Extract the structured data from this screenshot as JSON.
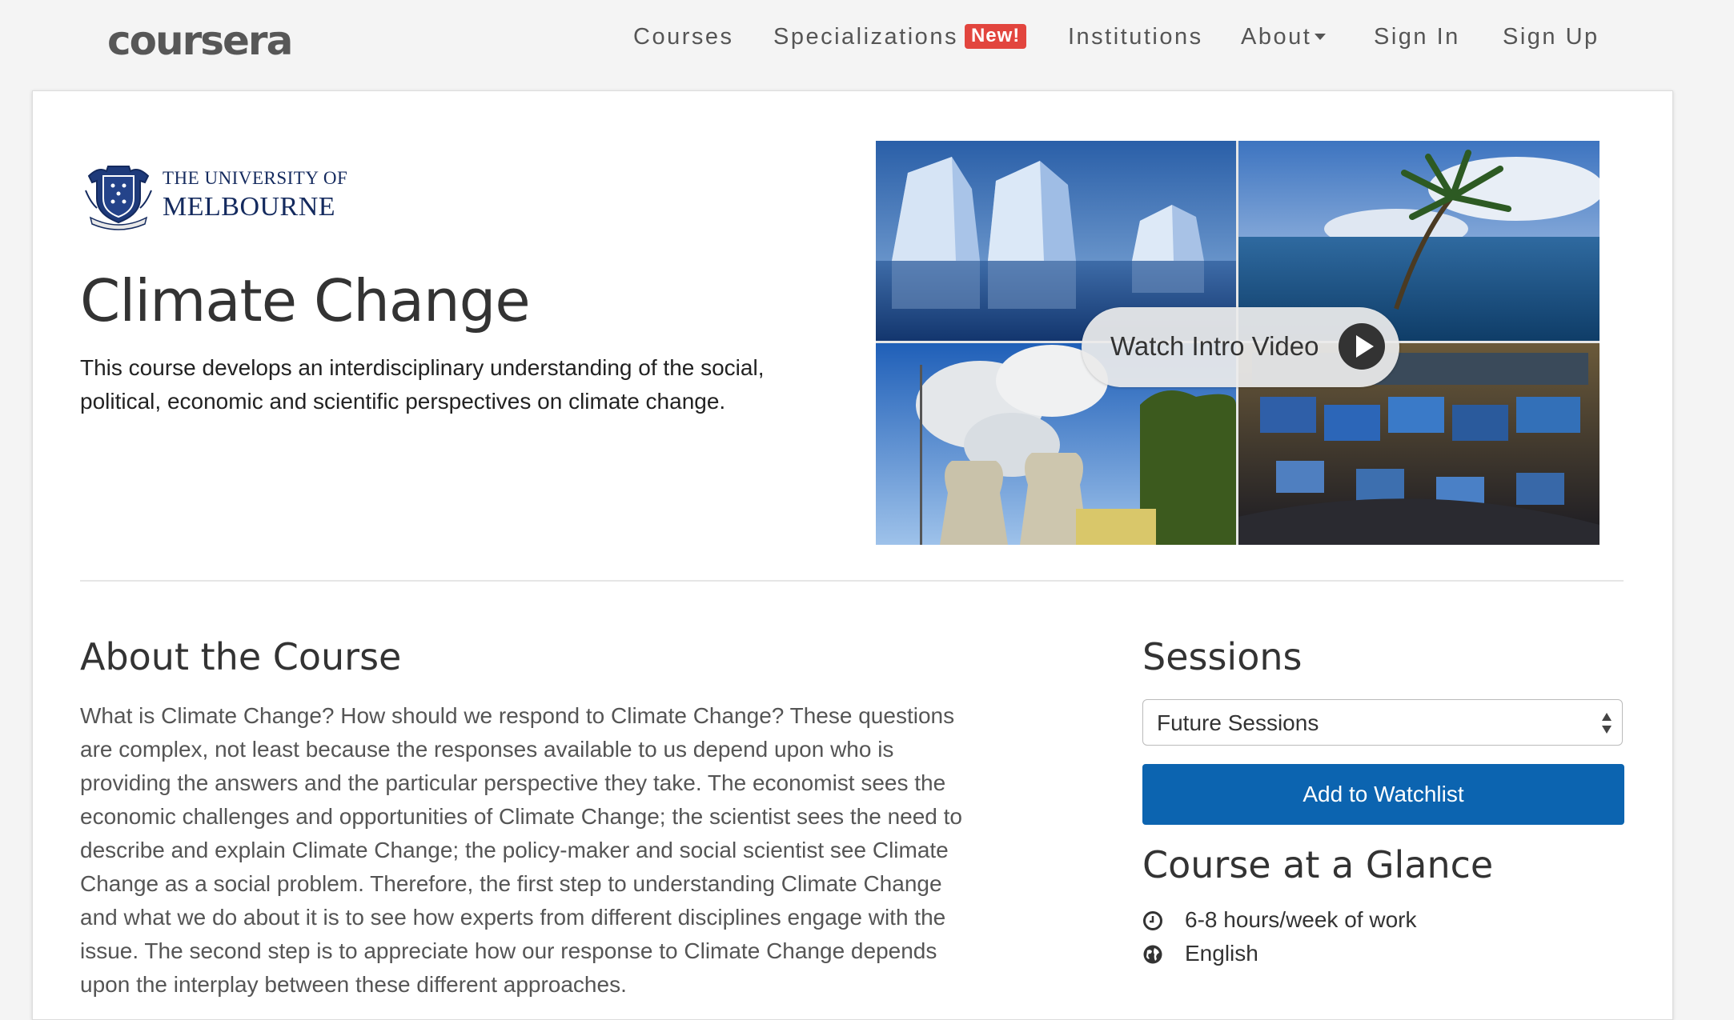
{
  "header": {
    "logo_text": "coursera",
    "nav": {
      "courses": "Courses",
      "specializations": "Specializations",
      "new_badge": "New!",
      "institutions": "Institutions",
      "about": "About",
      "sign_in": "Sign In",
      "sign_up": "Sign Up"
    }
  },
  "institution": {
    "line1": "THE UNIVERSITY OF",
    "line2": "MELBOURNE"
  },
  "course": {
    "title": "Climate Change",
    "description": "This course develops an interdisciplinary understanding of the social, political, economic and scientific perspectives on climate change."
  },
  "video": {
    "button_label": "Watch Intro Video",
    "play_icon": "play-circle-icon"
  },
  "about": {
    "title": "About the Course",
    "body": "What is Climate Change? How should we respond to Climate Change? These questions are complex, not least because the responses available to us depend upon who is providing the answers and the particular perspective they take. The economist sees the economic challenges and opportunities of Climate Change; the scientist sees the need to describe and explain Climate Change; the policy-maker and social scientist see Climate Change as a social problem. Therefore, the first step to understanding Climate Change and what we do about it is to see how experts from different disciplines engage with the issue. The second step is to appreciate how our response to Climate Change depends upon the interplay between these different approaches."
  },
  "sessions": {
    "title": "Sessions",
    "selected": "Future Sessions",
    "watchlist_button": "Add to Watchlist"
  },
  "glance": {
    "title": "Course at a Glance",
    "items": [
      {
        "icon": "clock-icon",
        "text": "6-8 hours/week of work"
      },
      {
        "icon": "globe-icon",
        "text": "English"
      }
    ]
  },
  "colors": {
    "badge": "#e2453e",
    "primary_button": "#0c64b0",
    "institution_navy": "#142a5e"
  }
}
